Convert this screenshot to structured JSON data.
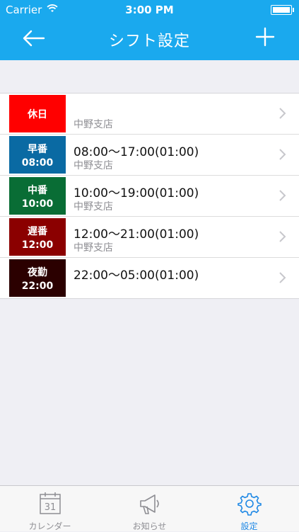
{
  "status_bar": {
    "carrier": "Carrier",
    "time": "3:00 PM"
  },
  "nav": {
    "title": "シフト設定"
  },
  "shifts": [
    {
      "label": "休日",
      "sub": "",
      "time": "",
      "place": "中野支店",
      "color": "#ff0000"
    },
    {
      "label": "早番",
      "sub": "08:00",
      "time": "08:00〜17:00(01:00)",
      "place": "中野支店",
      "color": "#0a6aa3"
    },
    {
      "label": "中番",
      "sub": "10:00",
      "time": "10:00〜19:00(01:00)",
      "place": "中野支店",
      "color": "#096d35"
    },
    {
      "label": "遅番",
      "sub": "12:00",
      "time": "12:00〜21:00(01:00)",
      "place": "中野支店",
      "color": "#8b0000"
    },
    {
      "label": "夜勤",
      "sub": "22:00",
      "time": "22:00〜05:00(01:00)",
      "place": "",
      "color": "#2b0000"
    }
  ],
  "tabs": [
    {
      "label": "カレンダー",
      "icon": "calendar-icon",
      "calendar_day": "31"
    },
    {
      "label": "お知らせ",
      "icon": "megaphone-icon"
    },
    {
      "label": "設定",
      "icon": "gear-icon"
    }
  ]
}
